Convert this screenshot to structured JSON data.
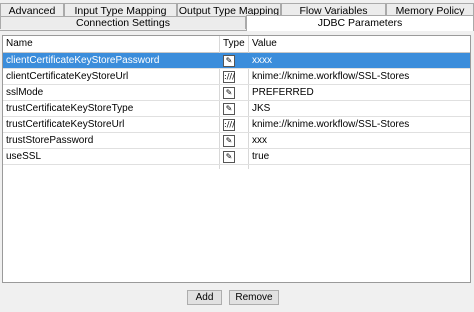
{
  "tabs": {
    "back": [
      "Advanced",
      "Input Type Mapping",
      "Output Type Mapping",
      "Flow Variables",
      "Memory Policy"
    ],
    "mid": [
      "Connection Settings",
      "JDBC Parameters"
    ],
    "active": "JDBC Parameters"
  },
  "table": {
    "headers": [
      "Name",
      "Type",
      "Value"
    ],
    "rows": [
      {
        "name": "clientCertificateKeyStorePassword",
        "type": "password-icon",
        "type_glyph": "✎",
        "value": "xxxx",
        "selected": true
      },
      {
        "name": "clientCertificateKeyStoreUrl",
        "type": "path-icon",
        "type_glyph": ":///",
        "value": "knime://knime.workflow/SSL-Stores",
        "selected": false
      },
      {
        "name": "sslMode",
        "type": "literal-icon",
        "type_glyph": "✎",
        "value": "PREFERRED",
        "selected": false
      },
      {
        "name": "trustCertificateKeyStoreType",
        "type": "literal-icon",
        "type_glyph": "✎",
        "value": "JKS",
        "selected": false
      },
      {
        "name": "trustCertificateKeyStoreUrl",
        "type": "path-icon",
        "type_glyph": ":///",
        "value": "knime://knime.workflow/SSL-Stores",
        "selected": false
      },
      {
        "name": "trustStorePassword",
        "type": "password-icon",
        "type_glyph": "✎",
        "value": "xxx",
        "selected": false
      },
      {
        "name": "useSSL",
        "type": "literal-icon",
        "type_glyph": "✎",
        "value": "true",
        "selected": false
      }
    ]
  },
  "buttons": {
    "add": "Add",
    "remove": "Remove"
  }
}
